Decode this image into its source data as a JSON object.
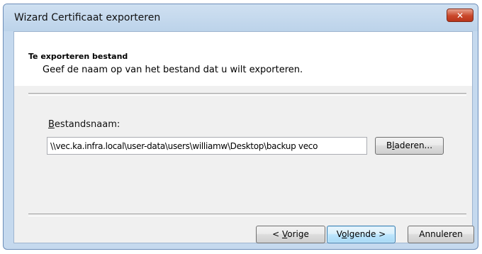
{
  "window": {
    "title": "Wizard Certificaat exporteren",
    "close_glyph": "✕"
  },
  "header": {
    "title": "Te exporteren bestand",
    "subtitle": "Geef de naam op van het bestand dat u wilt exporteren."
  },
  "form": {
    "filename_label_accel": "B",
    "filename_label_rest": "estandsnaam:",
    "filename_value": "\\\\vec.ka.infra.local\\user-data\\users\\williamw\\Desktop\\backup veco",
    "browse_pre": "B",
    "browse_accel": "l",
    "browse_post": "aderen..."
  },
  "footer": {
    "back_pre": "< ",
    "back_accel": "V",
    "back_post": "orige",
    "next_pre": "V",
    "next_accel": "o",
    "next_post": "lgende >",
    "cancel_label": "Annuleren"
  },
  "colors": {
    "frame": "#c5d9ee",
    "close_button": "#c9472a",
    "default_button_border": "#3c7fb1"
  }
}
